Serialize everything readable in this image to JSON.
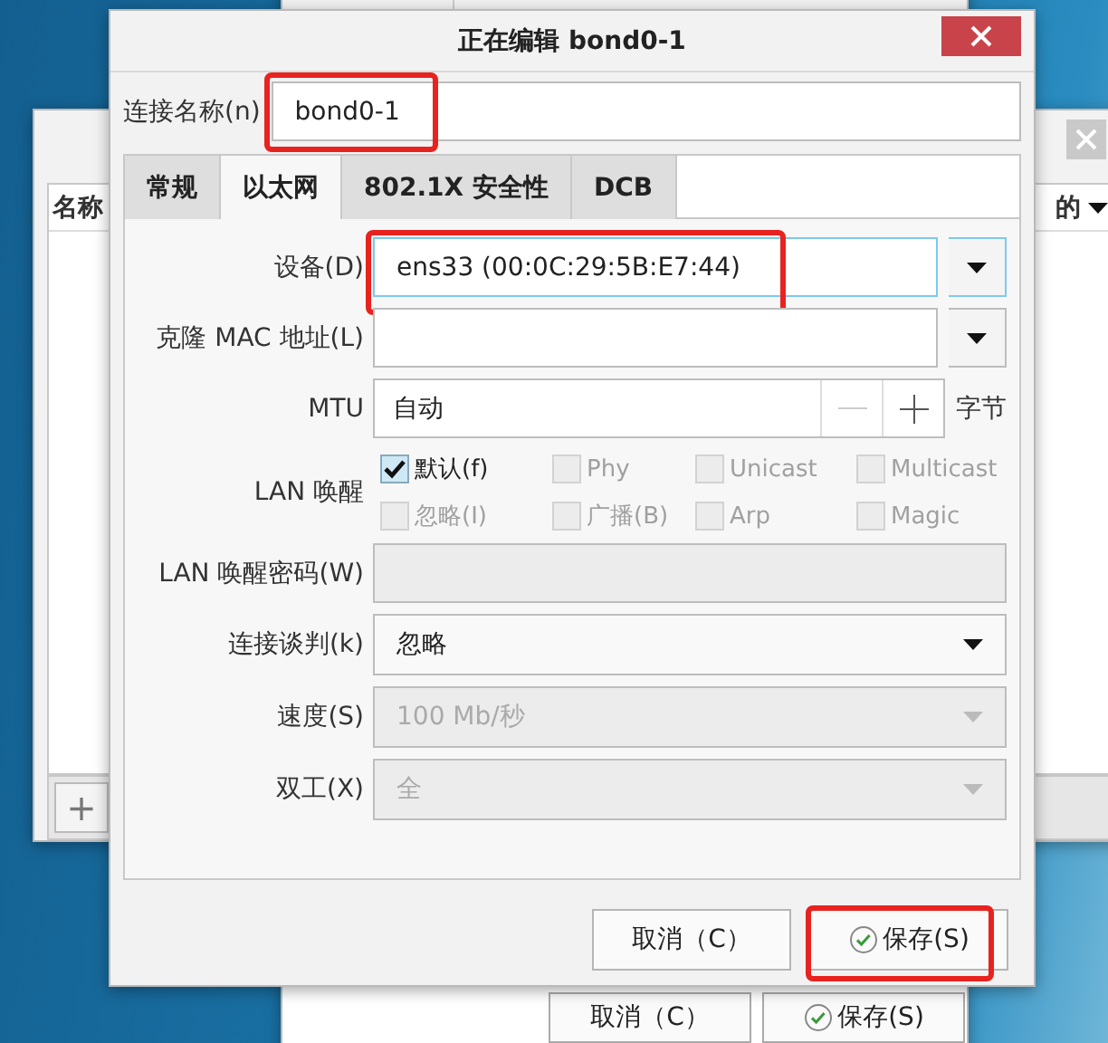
{
  "back_windows": {
    "list_window": {
      "column_1": "名称",
      "column_2": "的",
      "add": "+"
    },
    "lower_window": {
      "buttons": [
        {
          "label": "取消（C）",
          "kind": "plain"
        },
        {
          "label": "保存(S)",
          "kind": "confirm"
        }
      ]
    }
  },
  "dialog": {
    "title": "正在编辑 bond0-1",
    "connection_name": {
      "label": "连接名称(n)",
      "value": "bond0-1",
      "highlighted": true
    },
    "tabs": [
      {
        "label": "常规",
        "selected": false
      },
      {
        "label": "以太网",
        "selected": true
      },
      {
        "label": "802.1X 安全性",
        "selected": false
      },
      {
        "label": "DCB",
        "selected": false
      }
    ],
    "fields": [
      {
        "kind": "combo",
        "label": "设备(D)",
        "value": "ens33 (00:0C:29:5B:E7:44)",
        "focused": true,
        "highlighted": true
      },
      {
        "kind": "combo",
        "label": "克隆 MAC 地址(L)",
        "focused": false
      },
      {
        "kind": "spin",
        "label": "MTU",
        "value": "自动",
        "unit": "字节"
      },
      {
        "kind": "checks",
        "label": "LAN 唤醒",
        "options": [
          {
            "label": "默认(f)",
            "checked": true,
            "disabled": false
          },
          {
            "label": "Phy",
            "checked": false,
            "disabled": true
          },
          {
            "label": "Unicast",
            "checked": false,
            "disabled": true
          },
          {
            "label": "Multicast",
            "checked": false,
            "disabled": true
          },
          {
            "label": "忽略(I)",
            "checked": false,
            "disabled": true
          },
          {
            "label": "广播(B)",
            "checked": false,
            "disabled": true
          },
          {
            "label": "Arp",
            "checked": false,
            "disabled": true
          },
          {
            "label": "Magic",
            "checked": false,
            "disabled": true
          }
        ]
      },
      {
        "kind": "text",
        "label": "LAN 唤醒密码(W)",
        "disabled": true
      },
      {
        "kind": "dropdown",
        "label": "连接谈判(k)",
        "value": "忽略",
        "disabled": false
      },
      {
        "kind": "dropdown",
        "label": "速度(S)",
        "value": "100 Mb/秒",
        "disabled": true
      },
      {
        "kind": "dropdown",
        "label": "双工(X)",
        "value": "全",
        "disabled": true
      }
    ],
    "buttons": [
      {
        "label": "取消（C）",
        "kind": "plain",
        "highlighted": false
      },
      {
        "label": "保存(S)",
        "kind": "confirm",
        "highlighted": true
      }
    ]
  }
}
